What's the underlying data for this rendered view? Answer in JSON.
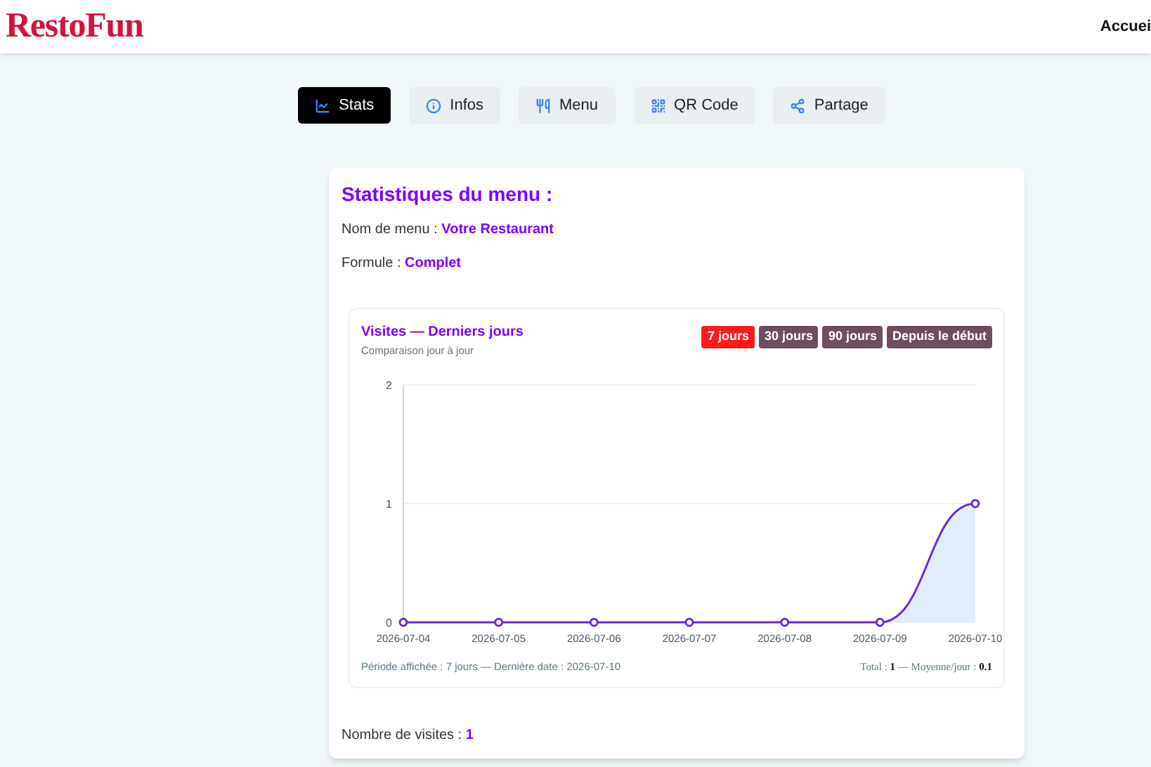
{
  "header": {
    "logo": "RestoFun",
    "nav_link": "Accuei"
  },
  "tabs": [
    {
      "label": "Stats",
      "selected": true
    },
    {
      "label": "Infos",
      "selected": false
    },
    {
      "label": "Menu",
      "selected": false
    },
    {
      "label": "QR Code",
      "selected": false
    },
    {
      "label": "Partage",
      "selected": false
    }
  ],
  "card": {
    "title": "Statistiques du menu :",
    "lines": [
      "Nom de menu : **Votre Restaurant**",
      "Formule : **Complet**"
    ],
    "chart_panel": {
      "title": "Visites — Derniers jours",
      "subtitle": "Comparaison jour à jour",
      "ranges": [
        {
          "label": "7 jours",
          "selected": true
        },
        {
          "label": "30 jours",
          "selected": false
        },
        {
          "label": "90 jours",
          "selected": false
        },
        {
          "label": "Depuis le début",
          "selected": false
        }
      ],
      "chart_data": {
        "type": "area",
        "categories": [
          "2026-07-04",
          "2026-07-05",
          "2026-07-06",
          "2026-07-07",
          "2026-07-08",
          "2026-07-09",
          "2026-07-10"
        ],
        "series": [
          {
            "color": "#6d28d9",
            "values": [
              0,
              0,
              0,
              0,
              0,
              0,
              1
            ]
          }
        ],
        "ylim": [
          0,
          2
        ],
        "yticks": [
          0,
          1,
          2
        ]
      },
      "footer_left": "Période affichée : 7 jours — Dernière date : 2026-07-10",
      "footer_right": "Total : **1** — Moyenne/jour : **0.1**"
    },
    "visits": "Nombre de visites : **1**"
  }
}
